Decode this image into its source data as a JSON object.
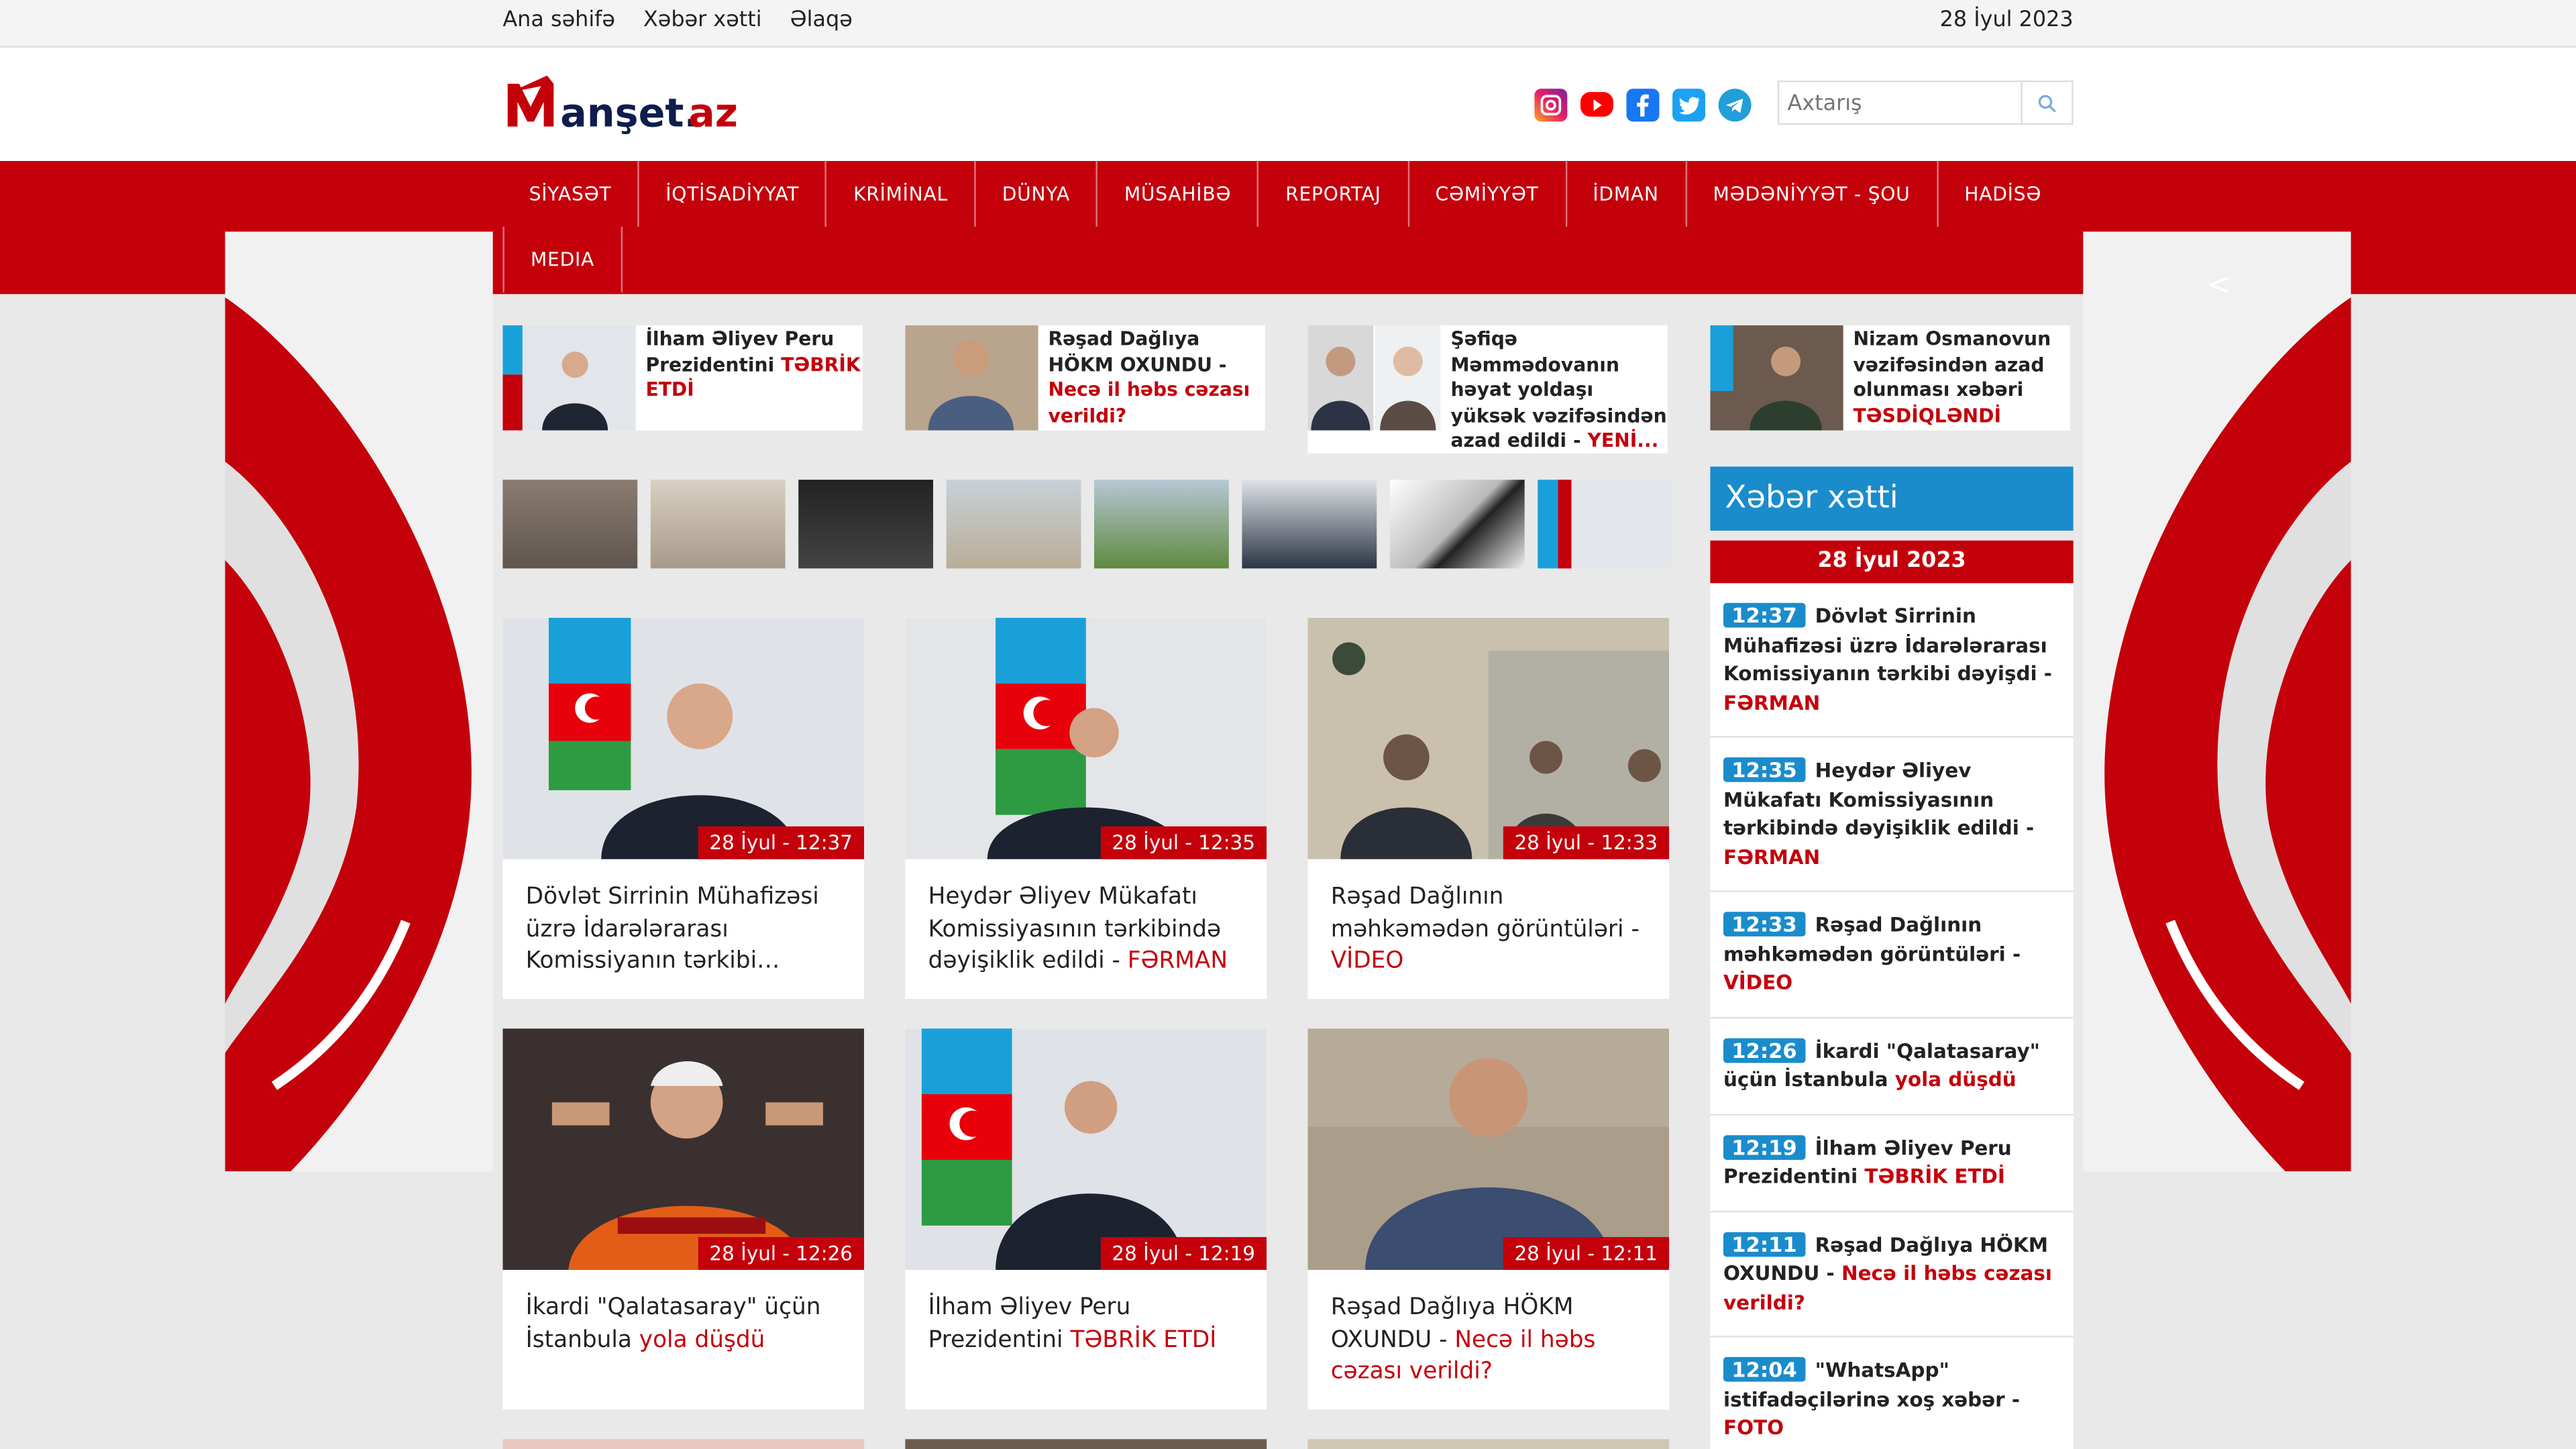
{
  "topbar": {
    "links": [
      "Ana səhifə",
      "Xəbər xətti",
      "Əlaqə"
    ],
    "date": "28 İyul 2023"
  },
  "header": {
    "logo_text": "Manşet.az",
    "social_icons": [
      "instagram-icon",
      "youtube-icon",
      "facebook-icon",
      "twitter-icon",
      "telegram-icon"
    ],
    "search_placeholder": "Axtarış"
  },
  "nav": {
    "row1": [
      "SİYASƏT",
      "İQTİSADİYYAT",
      "KRİMİNAL",
      "DÜNYA",
      "MÜSAHİBƏ",
      "REPORTAJ",
      "CƏMİYYƏT",
      "İDMAN",
      "MƏDƏNİYYƏT - ŞOU",
      "HADİSƏ"
    ],
    "row2": [
      "MEDIA"
    ]
  },
  "side_banner": {
    "arrow": "<"
  },
  "top_items": [
    {
      "title": "İlham Əliyev Peru Prezidentini ",
      "highlight": "TƏBRİK ETDİ"
    },
    {
      "title": "Rəşad Dağlıya HÖKM OXUNDU - ",
      "highlight": "Necə il həbs cəzası verildi?"
    },
    {
      "title": "Şəfiqə Məmmədovanın həyat yoldaşı yüksək vəzifəsindən azad edildi - ",
      "highlight": "YENİ..."
    },
    {
      "title": "Nizam Osmanovun vəzifəsindən azad olunması xəbəri ",
      "highlight": "TƏSDİQLƏNDİ"
    }
  ],
  "cards": [
    {
      "time": "28 İyul - 12:37",
      "title": "Dövlət Sirrinin Mühafizəsi üzrə İdarələrarası Komissiyanın tərkibi…",
      "highlight": ""
    },
    {
      "time": "28 İyul - 12:35",
      "title": "Heydər Əliyev Mükafatı Komissiyasının tərkibində dəyişiklik edildi - ",
      "highlight": "FƏRMAN"
    },
    {
      "time": "28 İyul - 12:33",
      "title": "Rəşad Dağlının məhkəmədən görüntüləri - ",
      "highlight": "VİDEO"
    },
    {
      "time": "28 İyul - 12:26",
      "title": "İkardi \"Qalatasaray\" üçün İstanbula ",
      "highlight": "yola düşdü"
    },
    {
      "time": "28 İyul - 12:19",
      "title": "İlham Əliyev Peru Prezidentini ",
      "highlight": "TƏBRİK ETDİ"
    },
    {
      "time": "28 İyul - 12:11",
      "title": "Rəşad Dağlıya HÖKM OXUNDU - ",
      "highlight": "Necə il həbs cəzası verildi?"
    }
  ],
  "sidebar": {
    "heading": "Xəbər xətti",
    "date": "28 İyul 2023",
    "items": [
      {
        "time": "12:37",
        "title": "Dövlət Sirrinin Mühafizəsi üzrə İdarələrarası Komissiyanın tərkibi dəyişdi - ",
        "highlight": "FƏRMAN"
      },
      {
        "time": "12:35",
        "title": "Heydər Əliyev Mükafatı Komissiyasının tərkibində dəyişiklik edildi - ",
        "highlight": "FƏRMAN"
      },
      {
        "time": "12:33",
        "title": "Rəşad Dağlının məhkəmədən görüntüləri - ",
        "highlight": "VİDEO"
      },
      {
        "time": "12:26",
        "title": "İkardi \"Qalatasaray\" üçün İstanbula ",
        "highlight": "yola düşdü"
      },
      {
        "time": "12:19",
        "title": "İlham Əliyev Peru Prezidentini ",
        "highlight": "TƏBRİK ETDİ"
      },
      {
        "time": "12:11",
        "title": "Rəşad Dağlıya HÖKM OXUNDU - ",
        "highlight": "Necə il həbs cəzası verildi?"
      },
      {
        "time": "12:04",
        "title": "\"WhatsApp\" istifadəçilərinə xoş xəbər - ",
        "highlight": "FOTO"
      }
    ]
  },
  "colors": {
    "brand_red": "#c4000b",
    "accent_blue": "#1a8ccc"
  }
}
